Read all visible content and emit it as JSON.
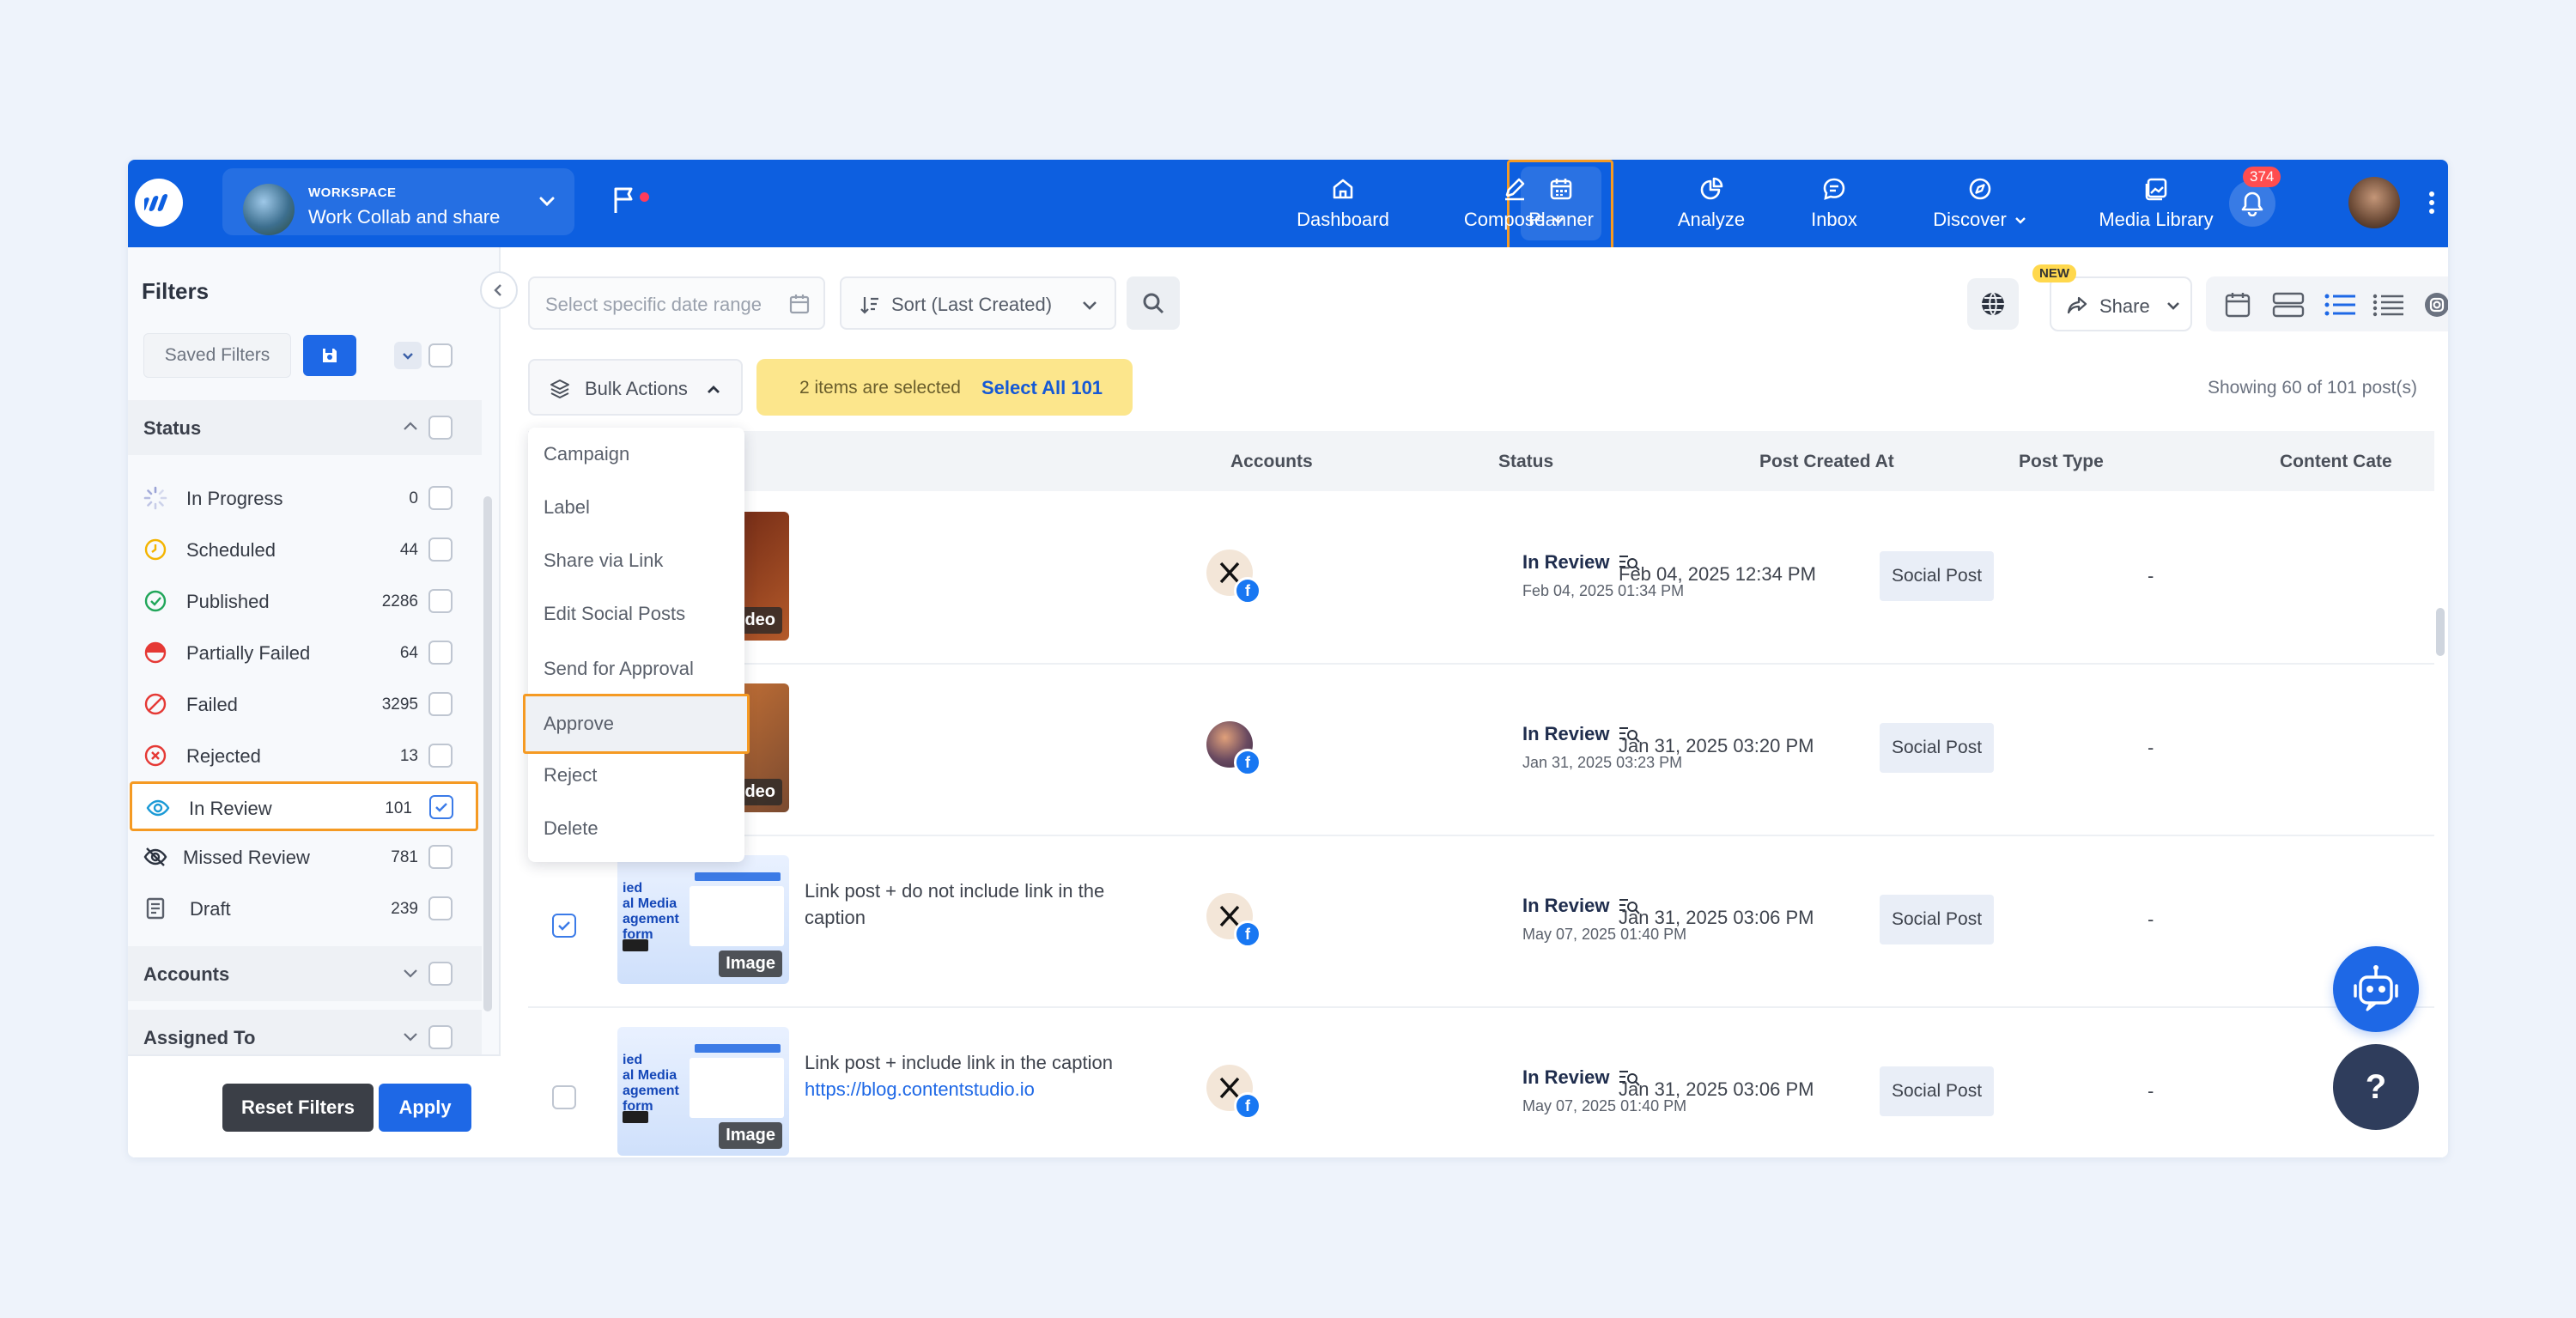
{
  "workspace": {
    "subtitle": "WORKSPACE",
    "name": "Work Collab and share"
  },
  "nav": [
    {
      "label": "Dashboard",
      "icon": "home-icon"
    },
    {
      "label": "Compose",
      "icon": "pen-icon"
    },
    {
      "label": "Planner",
      "icon": "calendar-icon",
      "active": true
    },
    {
      "label": "Analyze",
      "icon": "pie-chart-icon"
    },
    {
      "label": "Inbox",
      "icon": "chat-icon"
    },
    {
      "label": "Discover",
      "icon": "compass-icon"
    },
    {
      "label": "Media Library",
      "icon": "image-icon"
    }
  ],
  "notifications": {
    "count": "374"
  },
  "filters": {
    "title": "Filters",
    "saved_filters": "Saved Filters",
    "status_title": "Status",
    "statuses": [
      {
        "name": "In Progress",
        "count": "0",
        "icon": "spinner-icon"
      },
      {
        "name": "Scheduled",
        "count": "44",
        "icon": "clock-icon"
      },
      {
        "name": "Published",
        "count": "2286",
        "icon": "check-circle-icon"
      },
      {
        "name": "Partially Failed",
        "count": "64",
        "icon": "half-circle-icon"
      },
      {
        "name": "Failed",
        "count": "3295",
        "icon": "ban-icon"
      },
      {
        "name": "Rejected",
        "count": "13",
        "icon": "x-circle-icon"
      },
      {
        "name": "In Review",
        "count": "101",
        "icon": "eye-icon",
        "checked": true
      },
      {
        "name": "Missed Review",
        "count": "781",
        "icon": "eye-off-icon"
      },
      {
        "name": "Draft",
        "count": "239",
        "icon": "draft-icon"
      }
    ],
    "accounts_title": "Accounts",
    "assigned_title": "Assigned To",
    "reset": "Reset Filters",
    "apply": "Apply"
  },
  "toolbar": {
    "date_placeholder": "Select specific date range",
    "sort_label": "Sort (Last Created)",
    "share_label": "Share",
    "new_badge": "NEW"
  },
  "bulk": {
    "label": "Bulk Actions",
    "selected_text": "2 items are selected",
    "select_all": "Select All 101",
    "showing": "Showing 60 of 101 post(s)",
    "menu": [
      "Campaign",
      "Label",
      "Share via Link",
      "Edit Social Posts",
      "Send for Approval",
      "Approve",
      "Reject",
      "Delete"
    ]
  },
  "table": {
    "headers": {
      "accounts": "Accounts",
      "status": "Status",
      "created": "Post Created At",
      "type": "Post Type",
      "category": "Content Cate"
    },
    "rows": [
      {
        "media": "Video",
        "caption": "",
        "link": "",
        "status": "In Review",
        "status_time": "Feb 04, 2025 01:34 PM",
        "created": "Feb 04, 2025 12:34 PM",
        "type": "Social Post",
        "category": "-"
      },
      {
        "media": "Video",
        "caption": "",
        "link": "",
        "status": "In Review",
        "status_time": "Jan 31, 2025 03:23 PM",
        "created": "Jan 31, 2025 03:20 PM",
        "type": "Social Post",
        "category": "-"
      },
      {
        "media": "Image",
        "caption": "Link post + do not include link in the caption",
        "link": "",
        "status": "In Review",
        "status_time": "May 07, 2025 01:40 PM",
        "created": "Jan 31, 2025 03:06 PM",
        "type": "Social Post",
        "category": "-",
        "checked": true
      },
      {
        "media": "Image",
        "caption": "Link post + include link in the caption",
        "link": "https://blog.contentstudio.io",
        "status": "In Review",
        "status_time": "May 07, 2025 01:40 PM",
        "created": "Jan 31, 2025 03:06 PM",
        "type": "Social Post",
        "category": "-"
      }
    ],
    "thumb_text": "ied\nal Media\nagement\nform"
  },
  "help": {
    "label": "?"
  }
}
